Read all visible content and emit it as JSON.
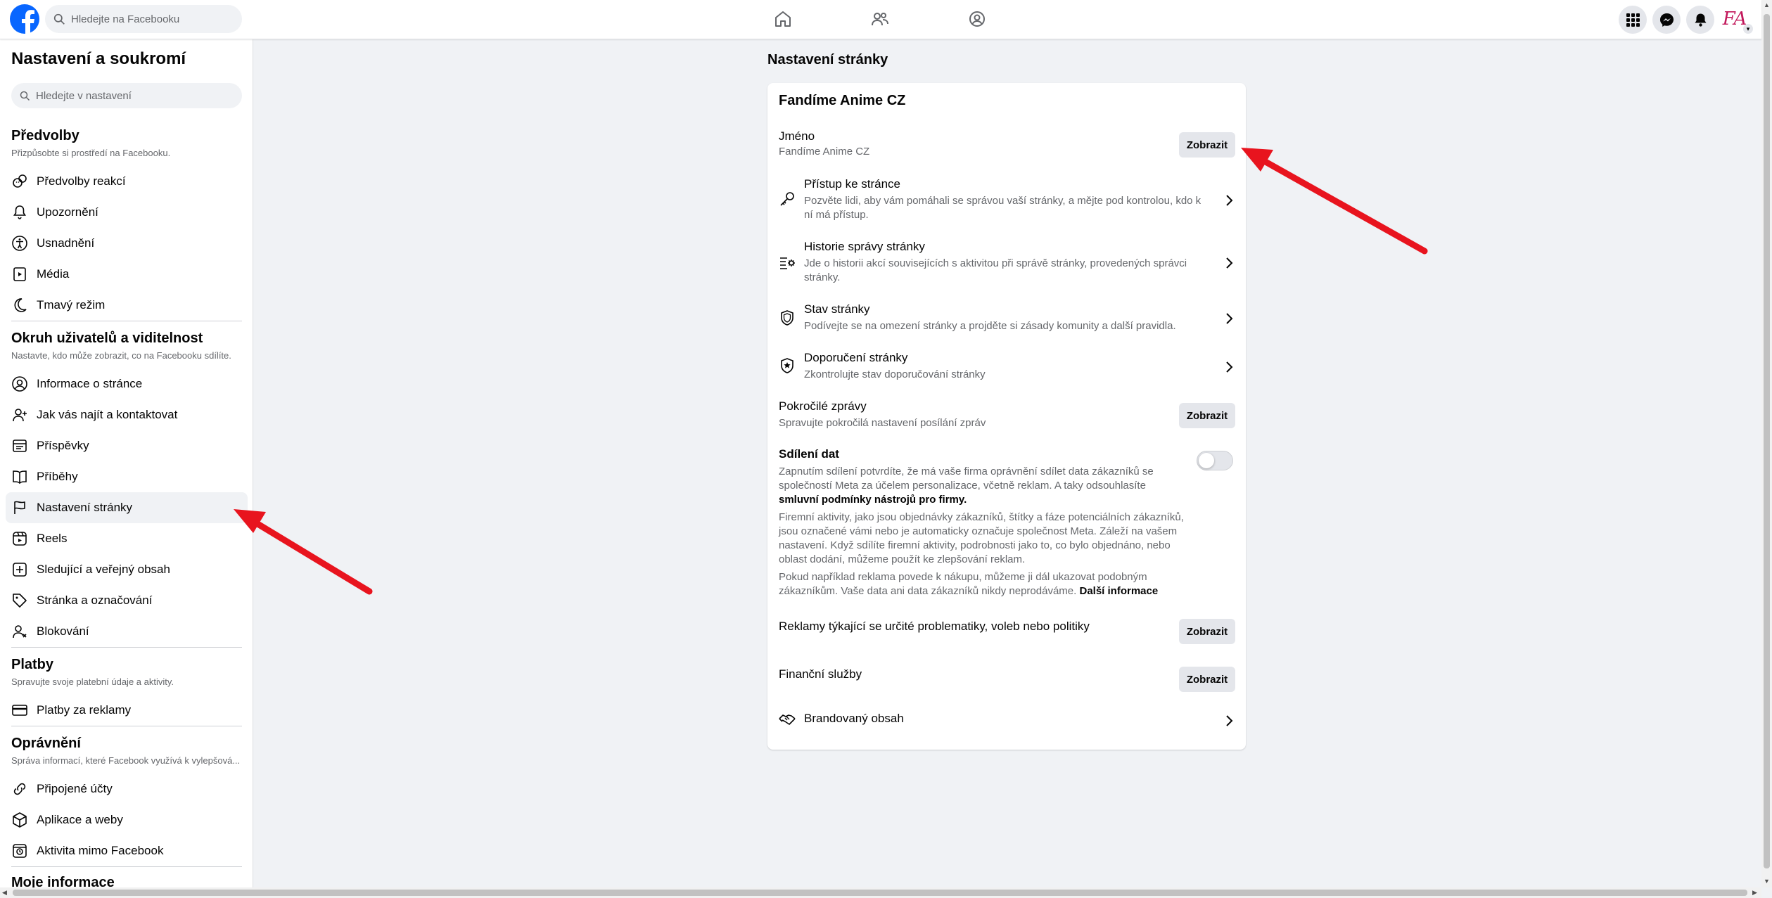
{
  "topbar": {
    "search_placeholder": "Hledejte na Facebooku",
    "avatar_initials": "FA",
    "brand_color": "#0866ff"
  },
  "sidebar": {
    "title": "Nastavení a soukromí",
    "search_placeholder": "Hledejte v nastavení",
    "sections": [
      {
        "title": "Předvolby",
        "desc": "Přizpůsobte si prostředí na Facebooku.",
        "items": [
          "Předvolby reakcí",
          "Upozornění",
          "Usnadnění",
          "Média",
          "Tmavý režim"
        ]
      },
      {
        "title": "Okruh uživatelů a viditelnost",
        "desc": "Nastavte, kdo může zobrazit, co na Facebooku sdílíte.",
        "items": [
          "Informace o stránce",
          "Jak vás najít a kontaktovat",
          "Příspěvky",
          "Příběhy",
          "Nastavení stránky",
          "Reels",
          "Sledující a veřejný obsah",
          "Stránka a označování",
          "Blokování"
        ]
      },
      {
        "title": "Platby",
        "desc": "Spravujte svoje platební údaje a aktivity.",
        "items": [
          "Platby za reklamy"
        ]
      },
      {
        "title": "Oprávnění",
        "desc": "Správa informací, které Facebook využívá k vylepšová...",
        "items": [
          "Připojené účty",
          "Aplikace a weby",
          "Aktivita mimo Facebook"
        ]
      },
      {
        "title": "Moje informace"
      }
    ]
  },
  "main": {
    "page_title": "Nastavení stránky",
    "card": {
      "title": "Fandíme Anime CZ",
      "name_row": {
        "title": "Jméno",
        "value": "Fandíme Anime CZ",
        "button": "Zobrazit"
      },
      "access_row": {
        "title": "Přístup ke stránce",
        "desc": "Pozvěte lidi, aby vám pomáhali se správou vaší stránky, a mějte pod kontrolou, kdo k ní má přístup."
      },
      "history_row": {
        "title": "Historie správy stránky",
        "desc": "Jde o historii akcí souvisejících s aktivitou při správě stránky, provedených správci stránky."
      },
      "status_row": {
        "title": "Stav stránky",
        "desc": "Podívejte se na omezení stránky a projděte si zásady komunity a další pravidla."
      },
      "recommend_row": {
        "title": "Doporučení stránky",
        "desc": "Zkontrolujte stav doporučování stránky"
      },
      "messages_row": {
        "title": "Pokročilé zprávy",
        "desc": "Spravujte pokročilá nastavení posílání zpráv",
        "button": "Zobrazit"
      },
      "data_sharing": {
        "title": "Sdílení dat",
        "toggle_on": false,
        "p1_text": "Zapnutím sdílení potvrdíte, že má vaše firma oprávnění sdílet data zákazníků se společností Meta za účelem personalizace, včetně reklam. A taky odsouhlasíte ",
        "p1_link": "smluvní podmínky nástrojů pro firmy.",
        "p2_text": "Firemní aktivity, jako jsou objednávky zákazníků, štítky a fáze potenciálních zákazníků, jsou označené vámi nebo je automaticky označuje společnost Meta. Záleží na vašem nastavení. Když sdílíte firemní aktivity, podrobnosti jako to, co bylo objednáno, nebo oblast dodání, můžeme použít ke zlepšování reklam.",
        "p3_text": "Pokud například reklama povede k nákupu, můžeme ji dál ukazovat podobným zákazníkům. Vaše data ani data zákazníků nikdy neprodáváme. ",
        "p3_link": "Další informace"
      },
      "political_ads_row": {
        "title": "Reklamy týkající se určité problematiky, voleb nebo politiky",
        "button": "Zobrazit"
      },
      "financial_row": {
        "title": "Finanční služby",
        "button": "Zobrazit"
      },
      "branded_row": {
        "title": "Brandovaný obsah"
      }
    }
  },
  "annotation_color": "#e8141e"
}
